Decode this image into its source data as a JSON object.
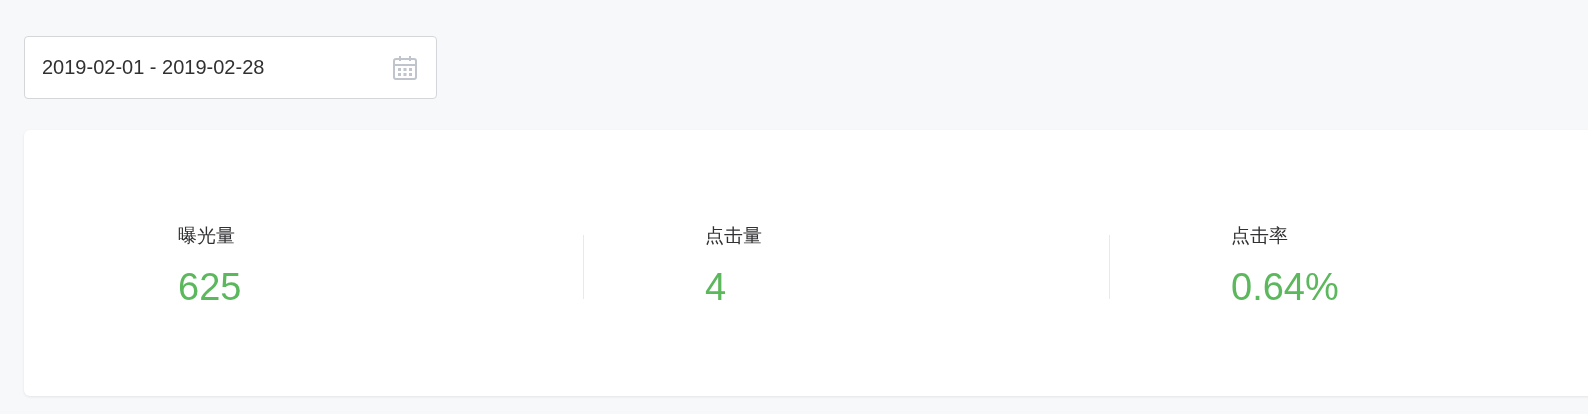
{
  "date_range": {
    "value": "2019-02-01 - 2019-02-28"
  },
  "stats": [
    {
      "label": "曝光量",
      "value": "625"
    },
    {
      "label": "点击量",
      "value": "4"
    },
    {
      "label": "点击率",
      "value": "0.64%"
    }
  ]
}
